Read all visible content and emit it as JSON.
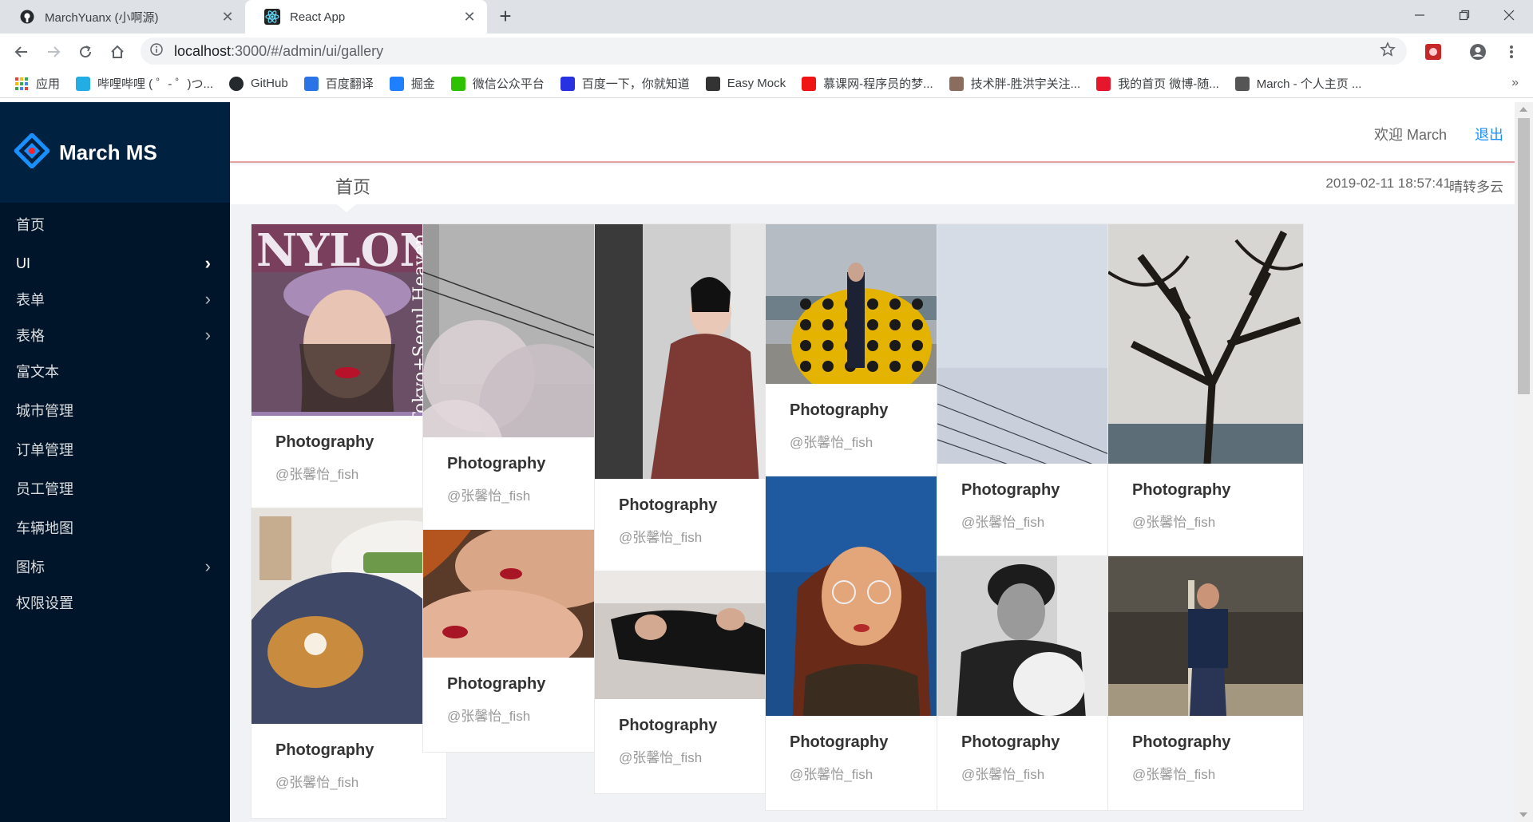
{
  "browser": {
    "tabs": [
      {
        "title": "MarchYuanx (小啊源)",
        "icon": "github-icon"
      },
      {
        "title": "React App",
        "icon": "react-icon"
      }
    ],
    "url_host": "localhost",
    "url_path": ":3000/#/admin/ui/gallery",
    "bookmarks": [
      {
        "label": "应用",
        "icon": "apps-grid-icon",
        "color": "#e94235"
      },
      {
        "label": "哔哩哔哩 ( ゜- ゜)つ...",
        "icon": "bilibili-icon",
        "color": "#23ade5"
      },
      {
        "label": "GitHub",
        "icon": "github-icon",
        "color": "#24292e"
      },
      {
        "label": "百度翻译",
        "icon": "baidu-translate-icon",
        "color": "#2b74e8"
      },
      {
        "label": "掘金",
        "icon": "juejin-icon",
        "color": "#1e80ff"
      },
      {
        "label": "微信公众平台",
        "icon": "wechat-icon",
        "color": "#2dc100"
      },
      {
        "label": "百度一下，你就知道",
        "icon": "baidu-paw-icon",
        "color": "#2932e1"
      },
      {
        "label": "Easy Mock",
        "icon": "easymock-icon",
        "color": "#333333"
      },
      {
        "label": "慕课网-程序员的梦...",
        "icon": "imooc-icon",
        "color": "#f01414"
      },
      {
        "label": "技术胖-胜洪宇关注...",
        "icon": "avatar-icon",
        "color": "#8a6d5f"
      },
      {
        "label": "我的首页 微博-随...",
        "icon": "weibo-icon",
        "color": "#e6162d"
      },
      {
        "label": "March - 个人主页 ...",
        "icon": "page-icon",
        "color": "#555555"
      }
    ]
  },
  "app": {
    "logo_text": "March MS",
    "menu": [
      {
        "label": "首页",
        "has_children": false,
        "active": false
      },
      {
        "label": "UI",
        "has_children": true,
        "active": true
      },
      {
        "label": "表单",
        "has_children": true,
        "active": false
      },
      {
        "label": "表格",
        "has_children": true,
        "active": false
      },
      {
        "label": "富文本",
        "has_children": false,
        "active": false
      },
      {
        "label": "城市管理",
        "has_children": false,
        "active": false
      },
      {
        "label": "订单管理",
        "has_children": false,
        "active": false
      },
      {
        "label": "员工管理",
        "has_children": false,
        "active": false
      },
      {
        "label": "车辆地图",
        "has_children": false,
        "active": false
      },
      {
        "label": "图标",
        "has_children": true,
        "active": false
      },
      {
        "label": "权限设置",
        "has_children": false,
        "active": false
      }
    ],
    "header": {
      "welcome": "欢迎 March",
      "logout": "退出"
    },
    "breadcrumb": {
      "title": "首页",
      "datetime": "2019-02-11 18:57:41",
      "weather": "晴转多云"
    },
    "accent_color": "#1890ff",
    "sidebar_color": "#001529",
    "gallery": [
      [
        {
          "title": "Photography",
          "author": "@张馨怡_fish",
          "photo": "nylon-magazine-cover"
        },
        {
          "title": "Photography",
          "author": "@张馨怡_fish",
          "photo": "dessert-plates"
        }
      ],
      [
        {
          "title": "Photography",
          "author": "@张馨怡_fish",
          "photo": "cherry-blossom-building"
        },
        {
          "title": "Photography",
          "author": "@张馨怡_fish",
          "photo": "two-faces-redlips"
        }
      ],
      [
        {
          "title": "Photography",
          "author": "@张馨怡_fish",
          "photo": "woman-red-satin-outfit"
        },
        {
          "title": "Photography",
          "author": "@张馨怡_fish",
          "photo": "girls-lying-on-bed"
        }
      ],
      [
        {
          "title": "Photography",
          "author": "@张馨怡_fish",
          "photo": "yellow-pumpkin-sculpture"
        },
        {
          "title": "Photography",
          "author": "@张馨怡_fish",
          "photo": "girl-glasses-sea"
        }
      ],
      [
        {
          "title": "Photography",
          "author": "@张馨怡_fish",
          "photo": "sky-power-lines"
        },
        {
          "title": "Photography",
          "author": "@张馨怡_fish",
          "photo": "woman-holding-cat-bw"
        }
      ],
      [
        {
          "title": "Photography",
          "author": "@张馨怡_fish",
          "photo": "bare-tree-sea"
        },
        {
          "title": "Photography",
          "author": "@张馨怡_fish",
          "photo": "street-night-woman"
        }
      ]
    ]
  }
}
